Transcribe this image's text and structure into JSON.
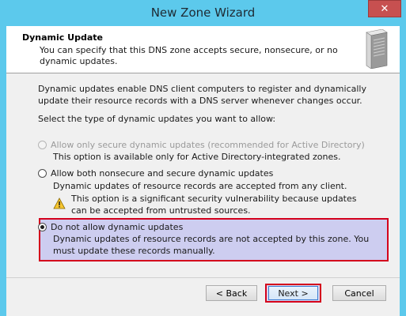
{
  "window": {
    "title": "New Zone Wizard",
    "close_label": "✕"
  },
  "header": {
    "title": "Dynamic Update",
    "description": "You can specify that this DNS zone accepts secure, nonsecure, or no dynamic updates."
  },
  "body": {
    "intro": "Dynamic updates enable DNS client computers to register and dynamically update their resource records with a DNS server whenever changes occur.",
    "prompt": "Select the type of dynamic updates you want to allow:"
  },
  "options": [
    {
      "label": "Allow only secure dynamic updates (recommended for Active Directory)",
      "note": "This option is available only for Active Directory-integrated zones.",
      "state": "disabled"
    },
    {
      "label": "Allow both nonsecure and secure dynamic updates",
      "note": "Dynamic updates of resource records are accepted from any client.",
      "warning": "This option is a significant security vulnerability because updates can be accepted from untrusted sources.",
      "state": "unchecked"
    },
    {
      "label": "Do not allow dynamic updates",
      "note": "Dynamic updates of resource records are not accepted by this zone. You must update these records manually.",
      "state": "checked"
    }
  ],
  "buttons": {
    "back": "< Back",
    "next": "Next >",
    "cancel": "Cancel"
  },
  "icons": {
    "server": "server-icon",
    "warning": "warning-icon"
  },
  "colors": {
    "title_bar": "#5cc9ec",
    "highlight_border": "#d4001c",
    "highlight_fill": "#cdcdf0"
  }
}
